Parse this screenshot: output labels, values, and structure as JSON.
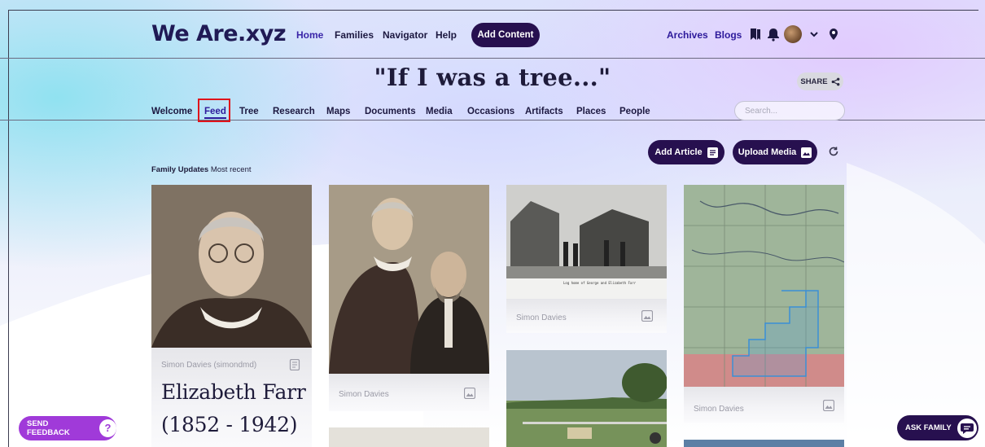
{
  "app": {
    "logo": "We Are.xyz"
  },
  "topnav": {
    "links": [
      "Home",
      "Families",
      "Navigator",
      "Help"
    ],
    "add_content": "Add Content",
    "right_links": [
      "Archives",
      "Blogs"
    ]
  },
  "family": {
    "title": "\"If I was a tree...\"",
    "share_label": "SHARE",
    "search_placeholder": "Search..."
  },
  "tabs": [
    "Welcome",
    "Feed",
    "Tree",
    "Research",
    "Maps",
    "Documents",
    "Media",
    "Occasions",
    "Artifacts",
    "Places",
    "People"
  ],
  "active_tab": "Feed",
  "actions": {
    "add_article": "Add Article",
    "upload_media": "Upload Media"
  },
  "feed": {
    "label": "Family Updates",
    "sort": "Most recent",
    "cards": [
      {
        "author": "Simon Davies (simondmd)",
        "type_icon": "article-icon",
        "title_line1": "Elizabeth Farr",
        "title_line2": "(1852 - 1942)"
      },
      {
        "author": "Simon Davies",
        "type_icon": "image-icon"
      },
      {
        "author": "Simon Davies",
        "type_icon": "image-icon",
        "caption": "Log home of George and Elizabeth Farr"
      },
      {
        "author": "Simon Davies",
        "type_icon": "image-icon"
      }
    ]
  },
  "floating": {
    "feedback": "SEND FEEDBACK",
    "ask_family": "ASK FAMILY"
  },
  "colors": {
    "brand_dark": "#27104f",
    "link_blue": "#2d1a9b",
    "highlight_red": "#e0141b",
    "feedback_purple": "#a03ad9"
  }
}
